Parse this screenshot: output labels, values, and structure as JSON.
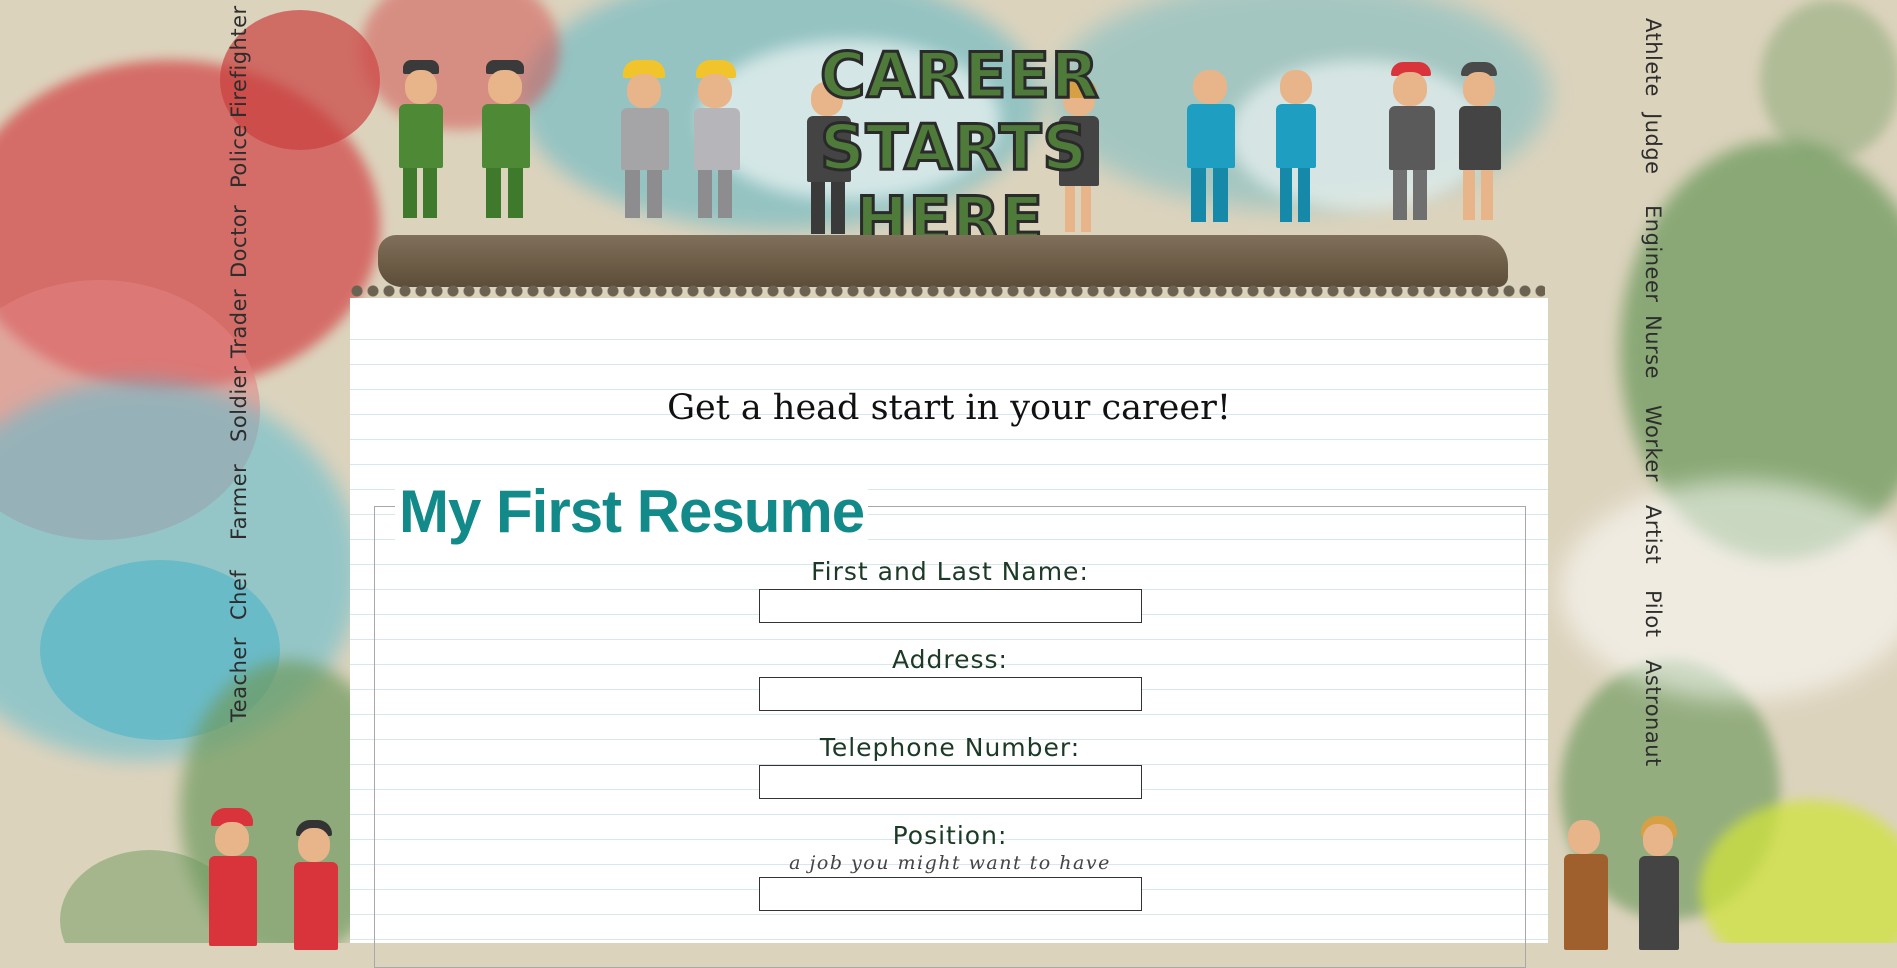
{
  "header": {
    "logo_line1": "CAREER",
    "logo_line2": "STARTS",
    "logo_line3": "HERE"
  },
  "left_nav": [
    "Firefighter",
    "Police",
    "Doctor",
    "Trader",
    "Soldier",
    "Farmer",
    "Chef",
    "Teacher"
  ],
  "right_nav": [
    "Athlete",
    "Judge",
    "Engineer",
    "Nurse",
    "Worker",
    "Artist",
    "Pilot",
    "Astronaut"
  ],
  "tagline": "Get a head start in your career!",
  "form": {
    "legend": "My First Resume",
    "fields": [
      {
        "label": "First and Last Name:",
        "value": "",
        "hint": ""
      },
      {
        "label": "Address:",
        "value": "",
        "hint": ""
      },
      {
        "label": "Telephone Number:",
        "value": "",
        "hint": ""
      },
      {
        "label": "Position:",
        "value": "",
        "hint": "a job you might want to have"
      }
    ]
  },
  "colors": {
    "background": "#dcd3bd",
    "splat_red": "#d24b4b",
    "splat_blue": "#3fb0c9",
    "splat_green": "#6e9a5e",
    "legend": "#128a8a",
    "logo_green": "#4e7a3a"
  }
}
